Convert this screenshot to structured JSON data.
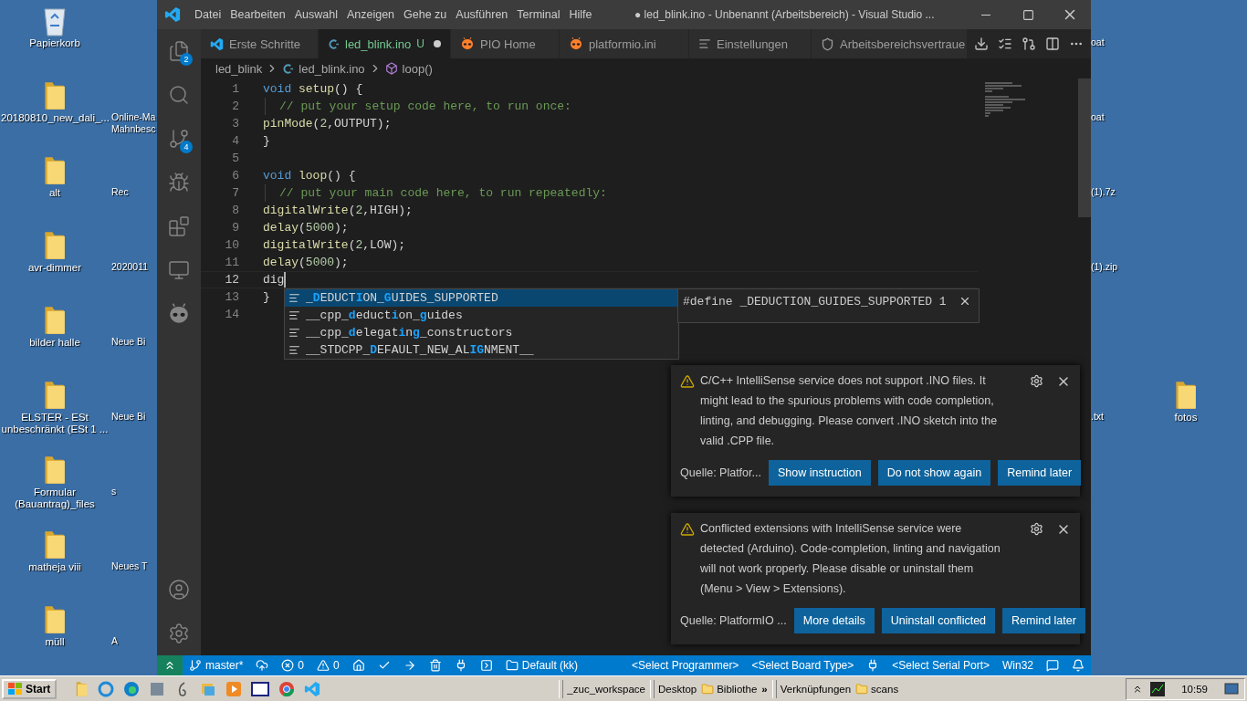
{
  "desktop": {
    "left_column": [
      {
        "label": "Papierkorb",
        "kind": "recycle_bin"
      },
      {
        "label": "20180810_new_dali_...",
        "kind": "folder"
      },
      {
        "label": "alt",
        "kind": "folder"
      },
      {
        "label": "avr-dimmer",
        "kind": "folder"
      },
      {
        "label": "bilder halle",
        "kind": "folder"
      },
      {
        "label": "ELSTER - ESt unbeschränkt (ESt 1 ...",
        "kind": "folder"
      },
      {
        "label": "Formular (Bauantrag)_files",
        "kind": "folder"
      },
      {
        "label": "matheja viii",
        "kind": "folder"
      },
      {
        "label": "müll",
        "kind": "folder"
      }
    ],
    "second_column": [
      {
        "kind": "empty"
      },
      {
        "kind": "label",
        "lines": [
          "Online-Ma",
          "Mahnbesc"
        ]
      },
      {
        "kind": "label",
        "lines": [
          "Rec"
        ]
      },
      {
        "kind": "label",
        "lines": [
          "2020011"
        ]
      },
      {
        "kind": "label",
        "lines": [
          "Neue Bi"
        ]
      },
      {
        "kind": "label",
        "lines": [
          "Neue Bi"
        ]
      },
      {
        "kind": "label",
        "lines": [
          "s"
        ]
      },
      {
        "kind": "label",
        "lines": [
          "Neues T"
        ]
      },
      {
        "kind": "label",
        "lines": [
          "A"
        ]
      }
    ],
    "right_column": [
      {
        "kind": "label",
        "label": "oat"
      },
      {
        "kind": "label",
        "label": "oat"
      },
      {
        "kind": "label",
        "label": "(1).7z"
      },
      {
        "kind": "label",
        "label": "(1).zip"
      },
      {
        "kind": "empty"
      },
      {
        "kind": "label",
        "label": ".txt"
      }
    ],
    "far_right_icons": [
      {
        "label": "fotos",
        "kind": "folder"
      }
    ]
  },
  "window": {
    "title": "● led_blink.ino - Unbenannt (Arbeitsbereich) - Visual Studio ...",
    "menu": [
      "Datei",
      "Bearbeiten",
      "Auswahl",
      "Anzeigen",
      "Gehe zu",
      "Ausführen",
      "Terminal",
      "Hilfe"
    ]
  },
  "activity_bar": {
    "top": [
      {
        "kind": "explorer",
        "badge": "2"
      },
      {
        "kind": "search"
      },
      {
        "kind": "source_control",
        "badge": "4"
      },
      {
        "kind": "run_debug"
      },
      {
        "kind": "extensions"
      },
      {
        "kind": "remote_explorer"
      },
      {
        "kind": "platformio"
      }
    ],
    "bottom": [
      {
        "kind": "accounts"
      },
      {
        "kind": "manage"
      }
    ]
  },
  "tabs": [
    {
      "label": "Erste Schritte",
      "kind": "welcome",
      "selected": false,
      "modified": false
    },
    {
      "label": "led_blink.ino",
      "kind": "cpp",
      "selected": true,
      "modified": true,
      "git_status": "U"
    },
    {
      "label": "PIO Home",
      "kind": "platformio",
      "selected": false,
      "modified": false
    },
    {
      "label": "platformio.ini",
      "kind": "platformio",
      "selected": false,
      "modified": false
    },
    {
      "label": "Einstellungen",
      "kind": "settings",
      "selected": false,
      "modified": false
    },
    {
      "label": "Arbeitsbereichsvertraue",
      "kind": "trust",
      "selected": false,
      "modified": false
    }
  ],
  "breadcrumb": [
    {
      "label": "led_blink",
      "kind": "folder"
    },
    {
      "label": "led_blink.ino",
      "kind": "cpp"
    },
    {
      "label": "loop()",
      "kind": "method"
    }
  ],
  "editor": {
    "lines": [
      {
        "number": "1",
        "active": false,
        "indented": false,
        "tokens": [
          {
            "kind": "keyword",
            "text": "void "
          },
          {
            "kind": "function",
            "text": "setup"
          },
          {
            "kind": "plain",
            "text": "() {"
          }
        ]
      },
      {
        "number": "2",
        "active": false,
        "indented": true,
        "tokens": [
          {
            "kind": "comment",
            "text": "// put your setup code here, to run once:"
          }
        ]
      },
      {
        "number": "3",
        "active": false,
        "indented": false,
        "tokens": [
          {
            "kind": "function",
            "text": "pinMode"
          },
          {
            "kind": "plain",
            "text": "("
          },
          {
            "kind": "number",
            "text": "2"
          },
          {
            "kind": "plain",
            "text": ",OUTPUT);"
          }
        ]
      },
      {
        "number": "4",
        "active": false,
        "indented": false,
        "tokens": [
          {
            "kind": "plain",
            "text": "}"
          }
        ]
      },
      {
        "number": "5",
        "active": false,
        "indented": false
      },
      {
        "number": "6",
        "active": false,
        "indented": false,
        "tokens": [
          {
            "kind": "keyword",
            "text": "void "
          },
          {
            "kind": "function",
            "text": "loop"
          },
          {
            "kind": "plain",
            "text": "() {"
          }
        ]
      },
      {
        "number": "7",
        "active": false,
        "indented": true,
        "tokens": [
          {
            "kind": "comment",
            "text": "// put your main code here, to run repeatedly:"
          }
        ]
      },
      {
        "number": "8",
        "active": false,
        "indented": false,
        "tokens": [
          {
            "kind": "function",
            "text": "digitalWrite"
          },
          {
            "kind": "plain",
            "text": "("
          },
          {
            "kind": "number",
            "text": "2"
          },
          {
            "kind": "plain",
            "text": ",HIGH);"
          }
        ]
      },
      {
        "number": "9",
        "active": false,
        "indented": false,
        "tokens": [
          {
            "kind": "function",
            "text": "delay"
          },
          {
            "kind": "plain",
            "text": "("
          },
          {
            "kind": "number",
            "text": "5000"
          },
          {
            "kind": "plain",
            "text": ");"
          }
        ]
      },
      {
        "number": "10",
        "active": false,
        "indented": false,
        "tokens": [
          {
            "kind": "function",
            "text": "digitalWrite"
          },
          {
            "kind": "plain",
            "text": "("
          },
          {
            "kind": "number",
            "text": "2"
          },
          {
            "kind": "plain",
            "text": ",LOW);"
          }
        ]
      },
      {
        "number": "11",
        "active": false,
        "indented": false,
        "tokens": [
          {
            "kind": "function",
            "text": "delay"
          },
          {
            "kind": "plain",
            "text": "("
          },
          {
            "kind": "number",
            "text": "5000"
          },
          {
            "kind": "plain",
            "text": ");"
          }
        ]
      },
      {
        "number": "12",
        "active": true,
        "indented": false,
        "tokens": [
          {
            "kind": "plain",
            "text": "dig"
          }
        ]
      },
      {
        "number": "13",
        "active": false,
        "indented": false,
        "tokens": [
          {
            "kind": "plain",
            "text": "}"
          }
        ]
      },
      {
        "number": "14",
        "active": false,
        "indented": false
      }
    ],
    "suggestions": [
      {
        "label": "_**D**EDUCT**I**ON_**G**UIDES_SUPPORTED",
        "selected": true
      },
      {
        "label": "__cpp_**d**educt**i**on_**g**uides",
        "selected": false
      },
      {
        "label": "__cpp_**d**elegat**i**n**g**_constructors",
        "selected": false
      },
      {
        "label": "__STDCPP_**D**EFAULT_NEW_AL**IG**NMENT__",
        "selected": false
      }
    ],
    "suggestion_detail": "#define _DEDUCTION_GUIDES_SUPPORTED 1"
  },
  "notifications": [
    {
      "message": "C/C++ IntelliSense service does not support .INO files. It might lead to the spurious problems with code completion, linting, and debugging. Please convert .INO sketch into the valid .CPP file.",
      "source": "Quelle: Platfor...",
      "buttons": [
        "Show instruction",
        "Do not show again",
        "Remind later"
      ]
    },
    {
      "message": "Conflicted extensions with IntelliSense service were detected (Arduino). Code-completion, linting and navigation will not work properly. Please disable or uninstall them (Menu > View > Extensions).",
      "source": "Quelle: PlatformIO ...",
      "buttons": [
        "More details",
        "Uninstall conflicted",
        "Remind later"
      ]
    }
  ],
  "status_bar": {
    "left": [
      {
        "kind": "remote"
      },
      {
        "kind": "branch",
        "text": "master*"
      },
      {
        "kind": "sync"
      },
      {
        "kind": "errors",
        "text": "0"
      },
      {
        "kind": "warnings",
        "text": "0"
      },
      {
        "kind": "home"
      },
      {
        "kind": "build"
      },
      {
        "kind": "upload"
      },
      {
        "kind": "clean"
      },
      {
        "kind": "serial_monitor"
      },
      {
        "kind": "terminal"
      },
      {
        "kind": "project_env",
        "text": "Default (kk)"
      }
    ],
    "right": [
      {
        "kind": "text",
        "text": "<Select Programmer>"
      },
      {
        "kind": "text",
        "text": "<Select Board Type>"
      },
      {
        "kind": "plug"
      },
      {
        "kind": "text",
        "text": "<Select Serial Port>"
      },
      {
        "kind": "text",
        "text": "Win32"
      },
      {
        "kind": "feedback"
      },
      {
        "kind": "notifications"
      }
    ]
  },
  "taskbar": {
    "start": "Start",
    "toolbars": [
      {
        "kind": "toolbar",
        "label": "_zuc_workspace"
      },
      {
        "kind": "toolbar",
        "label": "Desktop"
      },
      {
        "kind": "folder",
        "label": "Bibliothe"
      },
      {
        "kind": "chevron",
        "label": "»"
      },
      {
        "kind": "toolbar",
        "label": "Verknüpfungen"
      },
      {
        "kind": "folder",
        "label": "scans"
      }
    ],
    "clock": "10:59"
  }
}
